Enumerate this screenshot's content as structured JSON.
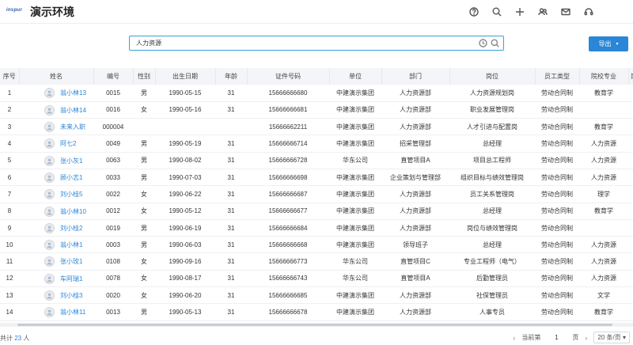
{
  "app": {
    "logo_text": "inspur",
    "title": "演示环境"
  },
  "top_icons": [
    "help-icon",
    "search-icon",
    "plus-icon",
    "contacts-icon",
    "mail-icon",
    "headset-icon"
  ],
  "search": {
    "value": "人力资源",
    "placeholder": ""
  },
  "toolbar": {
    "export_label": "导出",
    "export_caret": "▾"
  },
  "table": {
    "columns": [
      "序号",
      "姓名",
      "编号",
      "性别",
      "出生日期",
      "年龄",
      "证件号码",
      "单位",
      "部门",
      "岗位",
      "员工类型",
      "院校专业",
      "岗"
    ],
    "rows": [
      [
        "1",
        "翁小林13",
        "0015",
        "男",
        "1990-05-15",
        "31",
        "15666666680",
        "中建演示集团",
        "人力资源部",
        "人力资源规划岗",
        "劳动合同制",
        "教育学",
        ""
      ],
      [
        "2",
        "翁小林14",
        "0016",
        "女",
        "1990-05-16",
        "31",
        "15666666681",
        "中建演示集团",
        "人力资源部",
        "职业发展管理岗",
        "劳动合同制",
        "",
        ""
      ],
      [
        "3",
        "未来入职",
        "000004",
        "",
        "",
        "",
        "15666662211",
        "中建演示集团",
        "人力资源部",
        "人才引进与配置岗",
        "劳动合同制",
        "教育学",
        ""
      ],
      [
        "4",
        "阿七2",
        "0049",
        "男",
        "1990-05-19",
        "31",
        "15666666714",
        "中建演示集团",
        "招采管理部",
        "总经理",
        "劳动合同制",
        "人力资源",
        ""
      ],
      [
        "5",
        "张小灰1",
        "0063",
        "男",
        "1990-08-02",
        "31",
        "15666666728",
        "华东公司",
        "直管项目A",
        "项目总工程师",
        "劳动合同制",
        "人力资源",
        ""
      ],
      [
        "6",
        "顾小志1",
        "0033",
        "男",
        "1990-07-03",
        "31",
        "15666666698",
        "中建演示集团",
        "企业策划与管理部",
        "组织目标与绩效管理岗",
        "劳动合同制",
        "人力资源",
        ""
      ],
      [
        "7",
        "刘小桂5",
        "0022",
        "女",
        "1990-06-22",
        "31",
        "15666666687",
        "中建演示集团",
        "人力资源部",
        "员工关系管理岗",
        "劳动合同制",
        "理学",
        ""
      ],
      [
        "8",
        "翁小林10",
        "0012",
        "女",
        "1990-05-12",
        "31",
        "15666666677",
        "中建演示集团",
        "人力资源部",
        "总经理",
        "劳动合同制",
        "教育学",
        ""
      ],
      [
        "9",
        "刘小桂2",
        "0019",
        "男",
        "1990-06-19",
        "31",
        "15666666684",
        "中建演示集团",
        "人力资源部",
        "岗位与绩效管理岗",
        "劳动合同制",
        "",
        ""
      ],
      [
        "10",
        "翁小林1",
        "0003",
        "男",
        "1990-06-03",
        "31",
        "15666666668",
        "中建演示集团",
        "领导班子",
        "总经理",
        "劳动合同制",
        "人力资源",
        ""
      ],
      [
        "11",
        "张小玫1",
        "0108",
        "女",
        "1990-09-16",
        "31",
        "15666666773",
        "华东公司",
        "直管项目C",
        "专业工程师（电气）",
        "劳动合同制",
        "人力资源",
        ""
      ],
      [
        "12",
        "车阿瑞1",
        "0078",
        "女",
        "1990-08-17",
        "31",
        "15666666743",
        "华东公司",
        "直管项目A",
        "后勤管理员",
        "劳动合同制",
        "人力资源",
        ""
      ],
      [
        "13",
        "刘小桂3",
        "0020",
        "女",
        "1990-06-20",
        "31",
        "15666666685",
        "中建演示集团",
        "人力资源部",
        "社保管理员",
        "劳动合同制",
        "文学",
        ""
      ],
      [
        "14",
        "翁小林11",
        "0013",
        "男",
        "1990-05-13",
        "31",
        "15666666678",
        "中建演示集团",
        "人力资源部",
        "人事专员",
        "劳动合同制",
        "教育学",
        ""
      ]
    ]
  },
  "footer": {
    "total_prefix": "共计",
    "total_count": "23",
    "total_suffix": "人",
    "prev_arrow": "‹",
    "current_label": "当前第",
    "current_page": "1",
    "page_suffix": "页",
    "next_arrow": "›",
    "page_size": "20 条/页 ▾"
  }
}
